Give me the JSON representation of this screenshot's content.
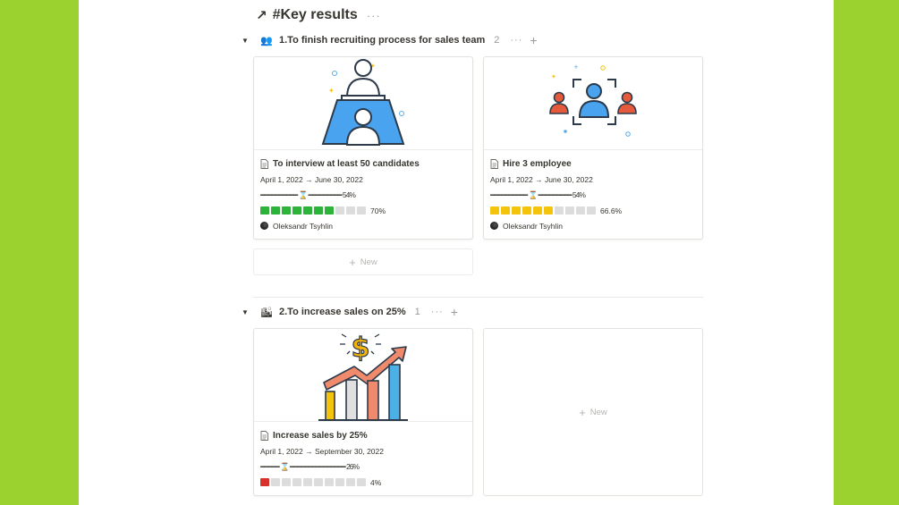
{
  "header": {
    "arrow": "↗",
    "title": "#Key results",
    "more": "···"
  },
  "groups": [
    {
      "emoji": "👥",
      "label": "1.To finish recruiting process for sales team",
      "count": "2",
      "more": "···",
      "add": "+",
      "cards": [
        {
          "title": "To interview at least 50 candidates",
          "dates": "April 1, 2022 → June 30, 2022",
          "time_bar": "━━━━━━━━━━ ⌛ ━━━━━━━━━ 54%",
          "progress": {
            "filled": 7,
            "total": 10,
            "color": "#2bb33a",
            "label": "70%"
          },
          "person": "Oleksandr Tsyhlin"
        },
        {
          "title": "Hire 3 employee",
          "dates": "April 1, 2022 → June 30, 2022",
          "time_bar": "━━━━━━━━━━ ⌛ ━━━━━━━━━ 54%",
          "progress": {
            "filled": 6,
            "total": 10,
            "color": "#f4c40c",
            "label": "66.6%"
          },
          "person": "Oleksandr Tsyhlin"
        }
      ],
      "new_label": "New"
    },
    {
      "emoji": "🏙",
      "label": "2.To increase sales on 25%",
      "count": "1",
      "more": "···",
      "add": "+",
      "cards": [
        {
          "title": "Increase sales by 25%",
          "dates": "April 1, 2022 → September 30, 2022",
          "time_bar": "━━━━━ ⌛ ━━━━━━━━━━━━━━━ 26%",
          "progress": {
            "filled": 1,
            "total": 10,
            "color": "#d9302c",
            "label": "4%"
          }
        }
      ],
      "new_label": "New"
    }
  ],
  "colors": {
    "background": "#9bd22f",
    "page": "#ffffff",
    "green": "#2bb33a",
    "yellow": "#f4c40c",
    "red": "#d9302c"
  }
}
